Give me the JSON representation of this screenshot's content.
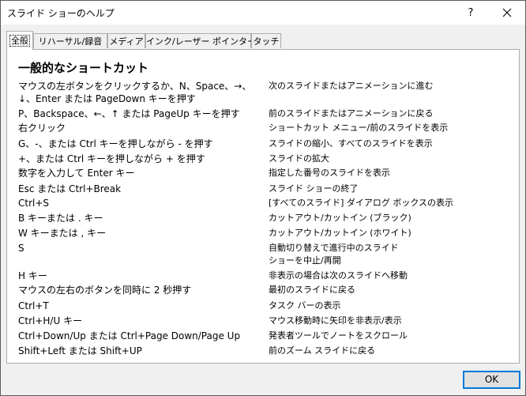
{
  "window": {
    "title": "スライド ショーのヘルプ",
    "help_label": "?"
  },
  "tabs": [
    {
      "label": "全般",
      "active": true
    },
    {
      "label": "リハーサル/録音",
      "active": false
    },
    {
      "label": "メディア",
      "active": false
    },
    {
      "label": "インク/レーザー ポインター",
      "active": false
    },
    {
      "label": "タッチ",
      "active": false
    }
  ],
  "section": {
    "title": "一般的なショートカット"
  },
  "shortcuts": [
    {
      "key": "マウスの左ボタンをクリックするか、N、Space、→、↓、Enter または PageDown キーを押す",
      "action": "次のスライドまたはアニメーションに進む"
    },
    {
      "key": "P、Backspace、←、↑ または PageUp キーを押す",
      "action": "前のスライドまたはアニメーションに戻る"
    },
    {
      "key": "右クリック",
      "action": "ショートカット メニュー/前のスライドを表示"
    },
    {
      "key": "G、-、または Ctrl キーを押しながら - を押す",
      "action": "スライドの縮小、すべてのスライドを表示"
    },
    {
      "key": "+、または Ctrl キーを押しながら + を押す",
      "action": "スライドの拡大"
    },
    {
      "key": "数字を入力して Enter キー",
      "action": "指定した番号のスライドを表示"
    },
    {
      "key": "Esc または Ctrl+Break",
      "action": "スライド ショーの終了"
    },
    {
      "key": "Ctrl+S",
      "action": "[すべてのスライド] ダイアログ ボックスの表示"
    },
    {
      "key": "B キーまたは . キー",
      "action": "カットアウト/カットイン (ブラック)"
    },
    {
      "key": "W キーまたは , キー",
      "action": "カットアウト/カットイン (ホワイト)"
    },
    {
      "key": "S",
      "action": "自動切り替えで進行中のスライド ショーを中止/再開"
    },
    {
      "key": "H キー",
      "action": "非表示の場合は次のスライドへ移動"
    },
    {
      "key": "マウスの左右のボタンを同時に 2 秒押す",
      "action": "最初のスライドに戻る"
    },
    {
      "key": "Ctrl+T",
      "action": "タスク バーの表示"
    },
    {
      "key": "Ctrl+H/U キー",
      "action": "マウス移動時に矢印を非表示/表示"
    },
    {
      "key": "Ctrl+Down/Up または Ctrl+Page Down/Page Up",
      "action": "発表者ツールでノートをスクロール"
    },
    {
      "key": "Shift+Left または Shift+UP",
      "action": "前のズーム スライドに戻る"
    }
  ],
  "buttons": {
    "ok_label": "OK"
  },
  "icons": {
    "close": "close-icon"
  },
  "colors": {
    "focus_border": "#0078d7",
    "dialog_bg": "#f0f0f0"
  }
}
